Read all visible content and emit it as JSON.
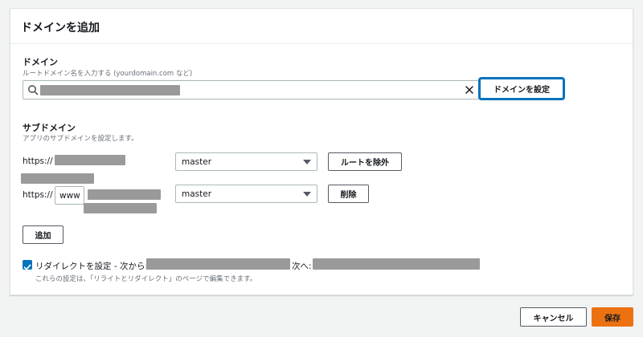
{
  "page": {
    "title": "ドメインを追加"
  },
  "domain": {
    "label": "ドメイン",
    "description": "ルートドメイン名を入力する (yourdomain.com など)",
    "icons": {
      "search": "search-icon",
      "clear": "close-icon"
    },
    "set_button": "ドメインを設定"
  },
  "subdomain": {
    "label": "サブドメイン",
    "description": "アプリのサブドメインを設定します。",
    "rows": [
      {
        "prefix": "https://",
        "branch": "master",
        "action": "ルートを除外"
      },
      {
        "prefix": "https://",
        "subdomain_value": "www",
        "branch": "master",
        "action": "削除"
      }
    ],
    "add_button": "追加"
  },
  "redirect": {
    "checked": true,
    "label": "リダイレクトを設定 - 次から:",
    "to_label": "次へ:",
    "note": "これらの設定は、「リライトとリダイレクト」のページで編集できます。"
  },
  "footer": {
    "cancel": "キャンセル",
    "save": "保存"
  },
  "colors": {
    "primary_button": "#ec7211",
    "checkbox": "#0073bb",
    "focus": "#0073bb"
  }
}
